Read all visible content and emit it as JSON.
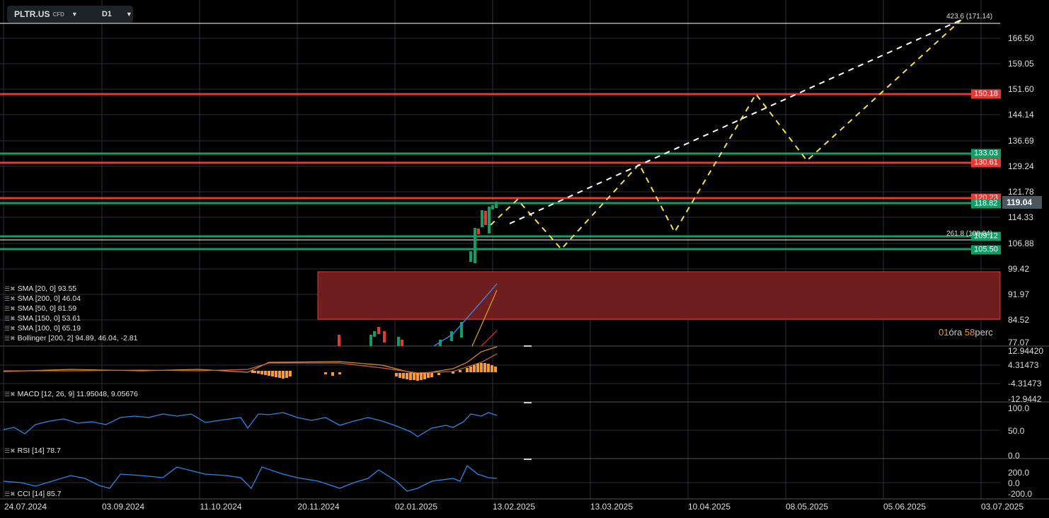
{
  "header": {
    "symbol": "PLTR.US",
    "symbol_type": "CFD",
    "timeframe": "D1"
  },
  "price_axis": [
    "166.50",
    "159.05",
    "151.60",
    "144.14",
    "136.69",
    "129.24",
    "121.78",
    "114.33",
    "106.88",
    "99.42",
    "91.97",
    "84.52",
    "77.07"
  ],
  "current_price": "119.04",
  "level_tags": [
    {
      "label": "150.18",
      "color": "#e53935"
    },
    {
      "label": "133.03",
      "color": "#0f9d68"
    },
    {
      "label": "130.61",
      "color": "#e53935"
    },
    {
      "label": "120.23",
      "color": "#e53935"
    },
    {
      "label": "118.82",
      "color": "#0f9d68"
    },
    {
      "label": "109.12",
      "color": "#0f9d68"
    },
    {
      "label": "105.50",
      "color": "#0f9d68"
    }
  ],
  "fib_top": "423.6 (171.14)",
  "fib_261": "261.8 (108.04)",
  "countdown": {
    "hours": "01",
    "hours_label": "óra",
    "minutes": "58",
    "minutes_label": "perc"
  },
  "legend": [
    "SMA [20, 0] 93.55",
    "SMA [200, 0] 46.04",
    "SMA [50, 0] 81.59",
    "SMA [150, 0] 53.61",
    "SMA [100, 0] 65.19",
    "Bollinger  [200, 2] 94.89,  46.04,  -2.81"
  ],
  "macd": {
    "label": "MACD [12, 26, 9] 11.95048,  9.05676",
    "axis": [
      "12.94420",
      "4.31473",
      "-4.31473",
      "-12.9442"
    ]
  },
  "rsi": {
    "label": "RSI [14] 78.7",
    "axis": [
      "100.0",
      "50.0",
      "0.0"
    ]
  },
  "cci": {
    "label": "CCI [14] 85.7",
    "axis": [
      "200.0",
      "0.0",
      "-200.0"
    ]
  },
  "dates": [
    "24.07.2024",
    "03.09.2024",
    "11.10.2024",
    "20.11.2024",
    "02.01.2025",
    "13.02.2025",
    "13.03.2025",
    "10.04.2025",
    "08.05.2025",
    "05.06.2025",
    "03.07.2025"
  ]
}
